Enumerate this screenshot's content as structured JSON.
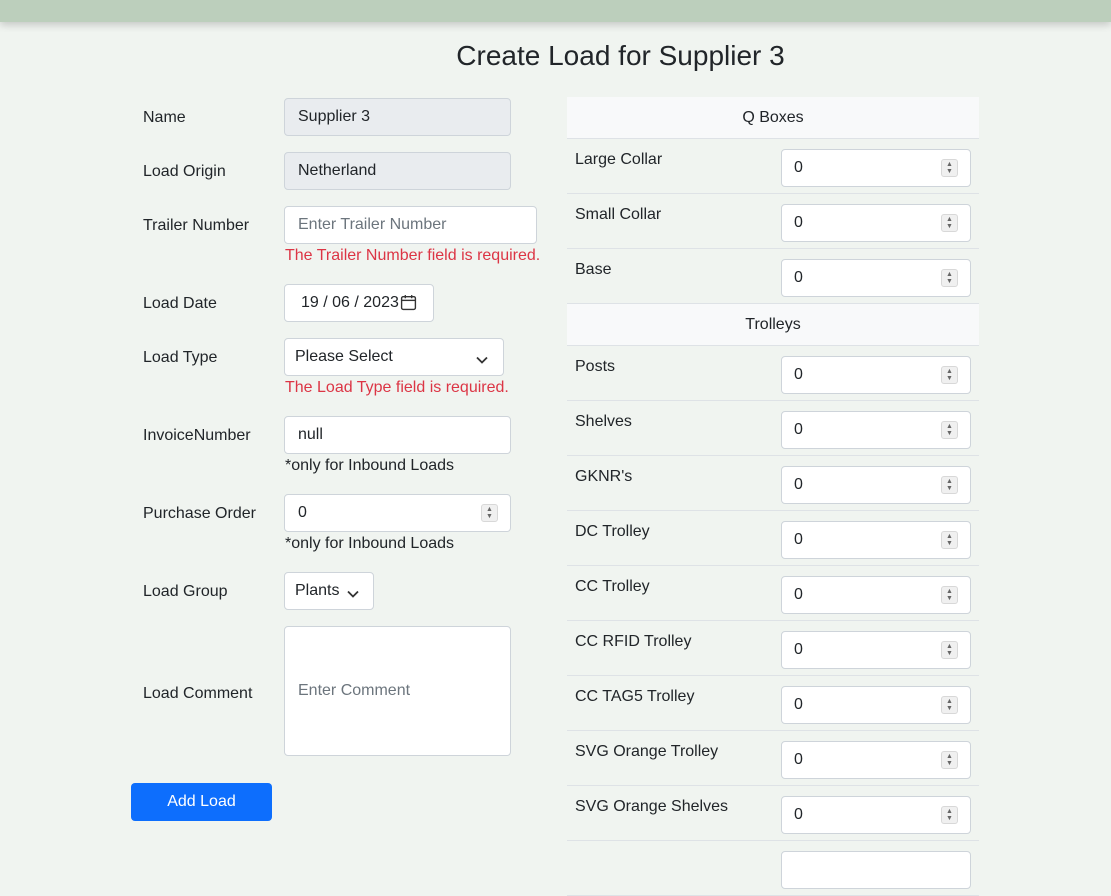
{
  "page_title": "Create Load for Supplier 3",
  "form": {
    "name_label": "Name",
    "name_value": "Supplier 3",
    "origin_label": "Load Origin",
    "origin_value": "Netherland",
    "trailer_label": "Trailer Number",
    "trailer_placeholder": "Enter Trailer Number",
    "trailer_error": "The Trailer Number field is required.",
    "date_label": "Load Date",
    "date_value": "19 / 06 / 2023",
    "type_label": "Load Type",
    "type_value": "Please Select",
    "type_error": "The Load Type field is required.",
    "invoice_label": "InvoiceNumber",
    "invoice_value": "null",
    "invoice_hint": "*only for Inbound Loads",
    "po_label": "Purchase Order",
    "po_value": "0",
    "po_hint": "*only for Inbound Loads",
    "group_label": "Load Group",
    "group_value": "Plants",
    "comment_label": "Load Comment",
    "comment_placeholder": "Enter Comment",
    "submit_label": "Add Load"
  },
  "q_boxes": {
    "header": "Q Boxes",
    "rows": [
      {
        "label": "Large Collar",
        "value": "0"
      },
      {
        "label": "Small Collar",
        "value": "0"
      },
      {
        "label": "Base",
        "value": "0"
      }
    ]
  },
  "trolleys": {
    "header": "Trolleys",
    "rows": [
      {
        "label": "Posts",
        "value": "0"
      },
      {
        "label": "Shelves",
        "value": "0"
      },
      {
        "label": "GKNR's",
        "value": "0"
      },
      {
        "label": "DC Trolley",
        "value": "0"
      },
      {
        "label": "CC Trolley",
        "value": "0"
      },
      {
        "label": "CC RFID Trolley",
        "value": "0"
      },
      {
        "label": "CC TAG5 Trolley",
        "value": "0"
      },
      {
        "label": "SVG Orange Trolley",
        "value": "0"
      },
      {
        "label": "SVG Orange Shelves",
        "value": "0"
      }
    ]
  },
  "colors": {
    "topbar": "#bccfbc",
    "background": "#f0f4f0",
    "primary": "#0d6efd",
    "error": "#dc3545"
  }
}
